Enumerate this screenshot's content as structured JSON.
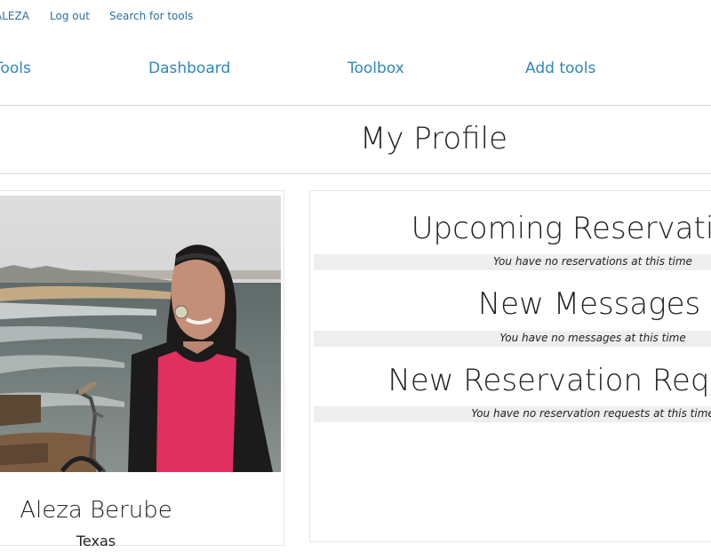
{
  "top_bar": {
    "user_link": "ALEZA",
    "logout_link": "Log out",
    "search_link": "Search for tools"
  },
  "nav": {
    "tools_label": "Tools",
    "dashboard_label": "Dashboard",
    "toolbox_label": "Toolbox",
    "add_tools_label": "Add tools"
  },
  "page": {
    "title": "My Profile"
  },
  "profile": {
    "name": "Aleza Berube",
    "location": "Texas"
  },
  "sections": [
    {
      "heading": "Upcoming Reservations",
      "empty_text": "You have no reservations at this time"
    },
    {
      "heading": "New Messages",
      "empty_text": "You have no messages at this time"
    },
    {
      "heading": "New Reservation Requests",
      "empty_text": "You have no reservation requests at this time"
    }
  ],
  "colors": {
    "link": "#2c6fa3",
    "nav_link": "#2f86b8",
    "empty_bar": "#eeeeee",
    "divider": "#d6d6d6"
  }
}
